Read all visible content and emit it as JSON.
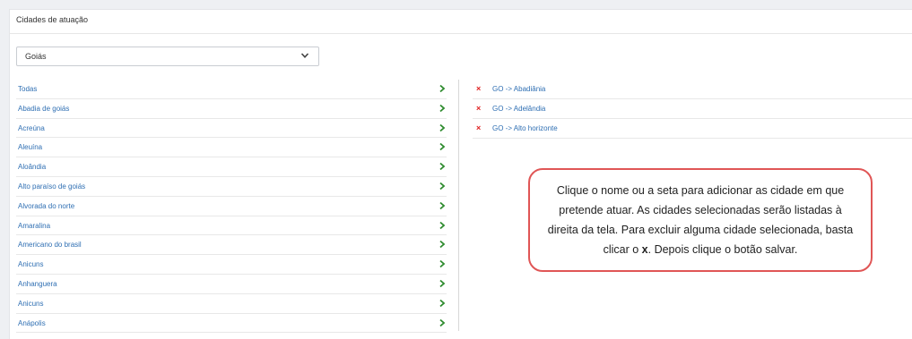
{
  "section": {
    "title": "Cidades de atuação"
  },
  "state_select": {
    "value": "Goiás"
  },
  "available_cities": [
    "Todas",
    "Abadia de goiás",
    "Acreúna",
    "Aleuína",
    "Aloândia",
    "Alto paraíso de goiás",
    "Alvorada do norte",
    "Amaralina",
    "Americano do brasil",
    "Anicuns",
    "Anhanguera",
    "Anicuns",
    "Anápolis"
  ],
  "selected_cities": [
    "GO -> Abadiânia",
    "GO -> Adelândia",
    "GO -> Alto horizonte"
  ],
  "callout": {
    "text_before": "Clique o nome ou a seta para adicionar as cidade em que pretende atuar. As cidades selecionadas serão listadas à direita da tela. Para excluir alguma cidade selecionada, basta clicar o ",
    "x_mark": "x",
    "text_after": ". Depois clique o botão salvar."
  },
  "colors": {
    "link": "#2f6fb3",
    "arrow": "#2e8b2e",
    "remove": "#e02020",
    "callout_border": "#e05656"
  },
  "icons": {
    "add": "chevron-right-icon",
    "remove": "close-icon",
    "select": "chevron-down-icon"
  }
}
